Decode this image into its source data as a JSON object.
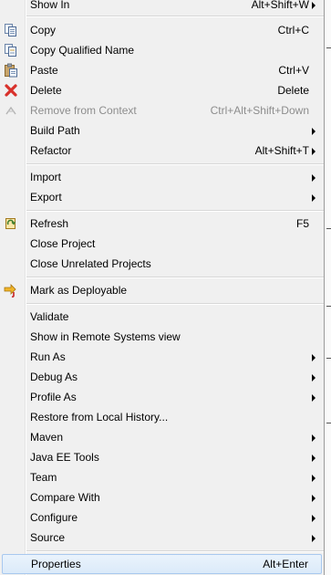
{
  "menu": {
    "items": [
      {
        "label": "Show In",
        "shortcut": "Alt+Shift+W",
        "submenu": true,
        "icon": ""
      },
      {
        "label": "Copy",
        "shortcut": "Ctrl+C",
        "icon": "copy-icon"
      },
      {
        "label": "Copy Qualified Name",
        "shortcut": "",
        "icon": "copy-qualified-name-icon"
      },
      {
        "label": "Paste",
        "shortcut": "Ctrl+V",
        "icon": "paste-icon"
      },
      {
        "label": "Delete",
        "shortcut": "Delete",
        "icon": "delete-icon"
      },
      {
        "label": "Remove from Context",
        "shortcut": "Ctrl+Alt+Shift+Down",
        "disabled": true,
        "icon": "remove-from-context-icon"
      },
      {
        "label": "Build Path",
        "shortcut": "",
        "submenu": true
      },
      {
        "label": "Refactor",
        "shortcut": "Alt+Shift+T",
        "submenu": true
      },
      {
        "label": "Import",
        "shortcut": "",
        "submenu": true
      },
      {
        "label": "Export",
        "shortcut": "",
        "submenu": true
      },
      {
        "label": "Refresh",
        "shortcut": "F5",
        "icon": "refresh-icon"
      },
      {
        "label": "Close Project",
        "shortcut": ""
      },
      {
        "label": "Close Unrelated Projects",
        "shortcut": ""
      },
      {
        "label": "Mark as Deployable",
        "shortcut": "",
        "icon": "mark-deployable-icon"
      },
      {
        "label": "Validate",
        "shortcut": ""
      },
      {
        "label": "Show in Remote Systems view",
        "shortcut": ""
      },
      {
        "label": "Run As",
        "shortcut": "",
        "submenu": true
      },
      {
        "label": "Debug As",
        "shortcut": "",
        "submenu": true
      },
      {
        "label": "Profile As",
        "shortcut": "",
        "submenu": true
      },
      {
        "label": "Restore from Local History...",
        "shortcut": ""
      },
      {
        "label": "Maven",
        "shortcut": "",
        "submenu": true
      },
      {
        "label": "Java EE Tools",
        "shortcut": "",
        "submenu": true
      },
      {
        "label": "Team",
        "shortcut": "",
        "submenu": true
      },
      {
        "label": "Compare With",
        "shortcut": "",
        "submenu": true
      },
      {
        "label": "Configure",
        "shortcut": "",
        "submenu": true
      },
      {
        "label": "Source",
        "shortcut": "",
        "submenu": true
      },
      {
        "label": "Properties",
        "shortcut": "Alt+Enter",
        "highlighted": true
      }
    ]
  },
  "colors": {
    "menu_background": "#f0f0f0",
    "highlight_border": "#a8c8ef",
    "disabled_text": "#8d8d8d",
    "delete_icon": "#d8312b",
    "refresh_icon": "#e2a21b",
    "deployable_arrow": "#e6a817"
  }
}
